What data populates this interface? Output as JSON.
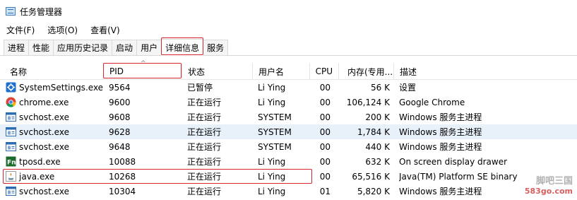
{
  "window": {
    "title": "任务管理器",
    "icon": "task-manager-icon"
  },
  "menu": [
    "文件(F)",
    "选项(O)",
    "查看(V)"
  ],
  "tabs": [
    "进程",
    "性能",
    "应用历史记录",
    "启动",
    "用户",
    "详细信息",
    "服务"
  ],
  "active_tab": "详细信息",
  "columns": {
    "name": "名称",
    "pid": "PID",
    "status": "状态",
    "user": "用户名",
    "cpu": "CPU",
    "memory": "内存(专用...",
    "desc": "描述"
  },
  "sort_column": "PID",
  "rows": [
    {
      "icon": "gear-icon",
      "name": "SystemSettings.exe",
      "pid": "9564",
      "status": "已暂停",
      "user": "Li Ying",
      "cpu": "00",
      "memory": "56 K",
      "desc": "设置"
    },
    {
      "icon": "chrome-icon",
      "name": "chrome.exe",
      "pid": "9600",
      "status": "正在运行",
      "user": "Li Ying",
      "cpu": "00",
      "memory": "106,124 K",
      "desc": "Google Chrome"
    },
    {
      "icon": "service-host-icon",
      "name": "svchost.exe",
      "pid": "9608",
      "status": "正在运行",
      "user": "SYSTEM",
      "cpu": "00",
      "memory": "200 K",
      "desc": "Windows 服务主进程"
    },
    {
      "icon": "service-host-icon",
      "name": "svchost.exe",
      "pid": "9628",
      "status": "正在运行",
      "user": "SYSTEM",
      "cpu": "00",
      "memory": "1,784 K",
      "desc": "Windows 服务主进程"
    },
    {
      "icon": "service-host-icon",
      "name": "svchost.exe",
      "pid": "9648",
      "status": "正在运行",
      "user": "SYSTEM",
      "cpu": "00",
      "memory": "440 K",
      "desc": "Windows 服务主进程"
    },
    {
      "icon": "tposd-icon",
      "name": "tposd.exe",
      "pid": "10088",
      "status": "正在运行",
      "user": "Li Ying",
      "cpu": "00",
      "memory": "632 K",
      "desc": "On screen display drawer"
    },
    {
      "icon": "java-icon",
      "name": "java.exe",
      "pid": "10268",
      "status": "正在运行",
      "user": "Li Ying",
      "cpu": "00",
      "memory": "65,516 K",
      "desc": "Java(TM) Platform SE binary"
    },
    {
      "icon": "service-host-icon",
      "name": "svchost.exe",
      "pid": "10304",
      "status": "正在运行",
      "user": "Li Ying",
      "cpu": "01",
      "memory": "5,820 K",
      "desc": "Windows 服务主进程"
    }
  ],
  "selected_row": 3,
  "highlighted_row": 6,
  "watermark": {
    "top": "脚吧三国",
    "bottom": "583go.com"
  },
  "colors": {
    "highlight_border": "#d8262e",
    "selected_row": "#e8f0fa"
  }
}
